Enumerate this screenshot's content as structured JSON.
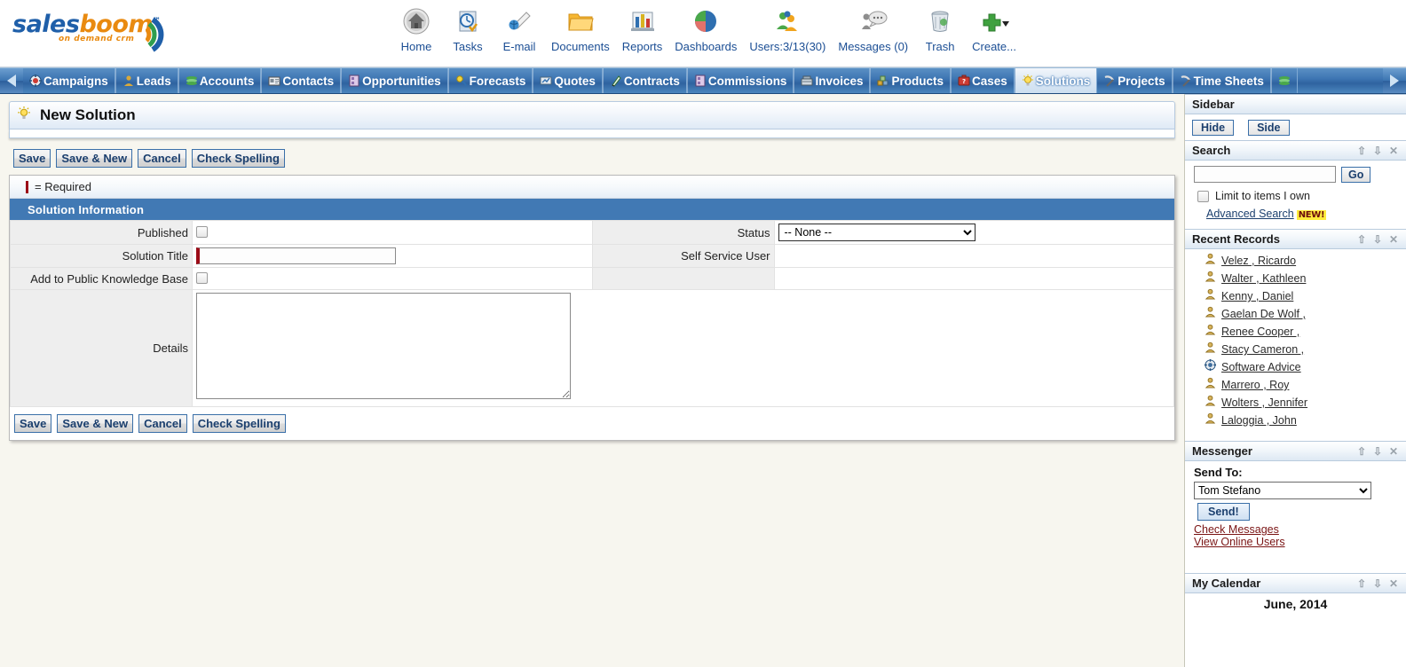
{
  "brand": {
    "name_part1": "sales",
    "name_part2": "boom",
    "tm": "™",
    "tagline": "on demand crm"
  },
  "topnav": [
    {
      "label": "Home",
      "icon": "home-icon"
    },
    {
      "label": "Tasks",
      "icon": "tasks-clock-icon"
    },
    {
      "label": "E-mail",
      "icon": "email-icon"
    },
    {
      "label": "Documents",
      "icon": "folder-icon"
    },
    {
      "label": "Reports",
      "icon": "reports-bar-chart-icon"
    },
    {
      "label": "Dashboards",
      "icon": "dashboards-pie-icon"
    },
    {
      "label": "Users:3/13(30)",
      "icon": "users-icon"
    },
    {
      "label": "Messages (0)",
      "icon": "messages-chat-icon"
    },
    {
      "label": "Trash",
      "icon": "trash-icon"
    },
    {
      "label": "Create...",
      "icon": "plus-dropdown-icon"
    }
  ],
  "tabnav": {
    "prev_label": "◀",
    "next_label": "▶",
    "active": "Solutions",
    "tabs": [
      {
        "label": "Campaigns",
        "icon": "campaigns-target-icon"
      },
      {
        "label": "Leads",
        "icon": "leads-person-icon"
      },
      {
        "label": "Accounts",
        "icon": "accounts-stack-icon"
      },
      {
        "label": "Contacts",
        "icon": "contacts-card-icon"
      },
      {
        "label": "Opportunities",
        "icon": "opportunities-door-icon"
      },
      {
        "label": "Forecasts",
        "icon": "forecasts-icon"
      },
      {
        "label": "Quotes",
        "icon": "quotes-icon"
      },
      {
        "label": "Contracts",
        "icon": "contracts-pen-icon"
      },
      {
        "label": "Commissions",
        "icon": "commissions-icon"
      },
      {
        "label": "Invoices",
        "icon": "invoices-register-icon"
      },
      {
        "label": "Products",
        "icon": "products-blocks-icon"
      },
      {
        "label": "Cases",
        "icon": "cases-briefcase-icon"
      },
      {
        "label": "Solutions",
        "icon": "solutions-bulb-icon"
      },
      {
        "label": "Projects",
        "icon": "projects-hammer-icon"
      },
      {
        "label": "Time Sheets",
        "icon": "timesheets-hammer-icon"
      }
    ],
    "overflow_icon": "stack-icon"
  },
  "main": {
    "page_title": "New Solution",
    "title_icon": "solutions-bulb-icon",
    "buttons": [
      {
        "label": "Save",
        "name": "save-button"
      },
      {
        "label": "Save & New",
        "name": "save-and-new-button"
      },
      {
        "label": "Cancel",
        "name": "cancel-button"
      },
      {
        "label": "Check Spelling",
        "name": "check-spelling-button"
      }
    ],
    "required_legend": "= Required",
    "section_header": "Solution Information",
    "fields": {
      "published_label": "Published",
      "published_checked": false,
      "status_label": "Status",
      "status_value": "-- None --",
      "status_options": [
        "-- None --"
      ],
      "solution_title_label": "Solution Title",
      "solution_title_value": "",
      "self_service_user_label": "Self Service User",
      "self_service_user_value": "",
      "add_public_kb_label": "Add to Public Knowledge Base",
      "add_public_kb_checked": false,
      "details_label": "Details",
      "details_value": ""
    }
  },
  "sidebar": {
    "title": "Sidebar",
    "hide_label": "Hide",
    "side_label": "Side",
    "search": {
      "title": "Search",
      "value": "",
      "placeholder": "",
      "go_label": "Go",
      "limit_label": "Limit to items I own",
      "limit_checked": false,
      "advanced_label": "Advanced Search",
      "new_badge": "NEW!"
    },
    "recent_records": {
      "title": "Recent Records",
      "items": [
        {
          "label": "Velez , Ricardo",
          "icon": "contact-person-icon"
        },
        {
          "label": "Walter , Kathleen",
          "icon": "contact-person-icon"
        },
        {
          "label": "Kenny , Daniel",
          "icon": "contact-person-icon"
        },
        {
          "label": "Gaelan De Wolf ,",
          "icon": "contact-person-icon"
        },
        {
          "label": "Renee Cooper ,",
          "icon": "contact-person-icon"
        },
        {
          "label": "Stacy Cameron ,",
          "icon": "contact-person-icon"
        },
        {
          "label": "Software Advice",
          "icon": "campaigns-target-icon"
        },
        {
          "label": "Marrero , Roy",
          "icon": "contact-person-icon"
        },
        {
          "label": "Wolters , Jennifer",
          "icon": "contact-person-icon"
        },
        {
          "label": "Laloggia , John",
          "icon": "contact-person-icon"
        }
      ]
    },
    "messenger": {
      "title": "Messenger",
      "send_to_label": "Send To:",
      "selected_user": "Tom Stefano",
      "options": [
        "Tom Stefano"
      ],
      "send_label": "Send!",
      "check_messages_label": "Check Messages",
      "view_online_label": "View Online Users"
    },
    "calendar": {
      "title": "My Calendar",
      "month": "June, 2014"
    },
    "panel_icons": {
      "up": "⇧",
      "down": "⇩",
      "close": "✕"
    }
  }
}
